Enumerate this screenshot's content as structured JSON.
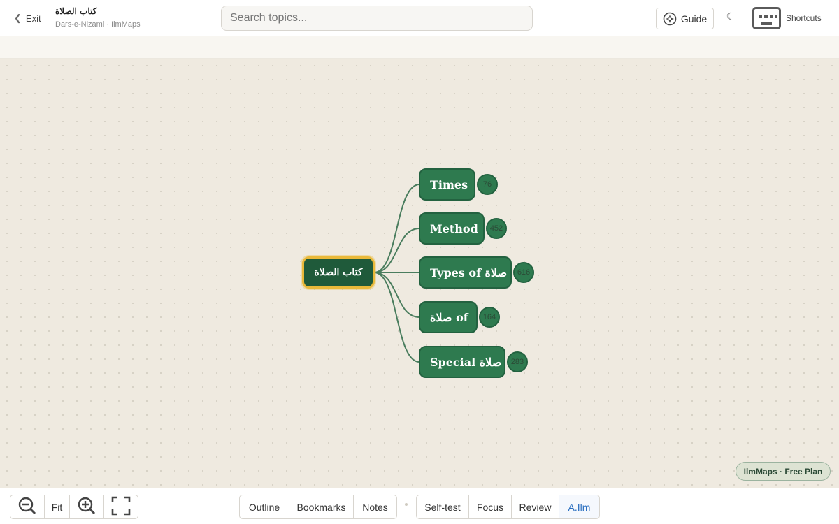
{
  "header": {
    "exit_label": "Exit",
    "title": "كتاب الصلاة",
    "subtitle": "Dars-e-Nizami · IlmMaps",
    "search_placeholder": "Search topics...",
    "guide_label": "Guide",
    "theme_icon": "moon-icon",
    "theme_glyph": "☾",
    "shortcuts_label": "Shortcuts"
  },
  "mindmap": {
    "root": {
      "label": "كتاب الصلاة"
    },
    "children": [
      {
        "label": "Times",
        "count": "76"
      },
      {
        "label": "Method",
        "count": "452"
      },
      {
        "label": "Types of صلاة",
        "count": "616"
      },
      {
        "label": "صلاة of",
        "count": "164"
      },
      {
        "label": "Special صلاة",
        "count": "283"
      }
    ]
  },
  "plan_badge": "IlmMaps · Free Plan",
  "bottom": {
    "zoom": {
      "zoom_out_icon": "zoom-out-icon",
      "fit_label": "Fit",
      "zoom_in_icon": "zoom-in-icon",
      "fullscreen_icon": "fullscreen-icon"
    },
    "panels": [
      "Outline",
      "Bookmarks",
      "Notes"
    ],
    "modes": [
      "Self-test",
      "Focus",
      "Review",
      "A.Ilm"
    ],
    "active_mode": "A.Ilm"
  },
  "colors": {
    "node": "#2e7a4f",
    "root": "#1f5a3a",
    "root_border": "#e9b93a",
    "edge": "#4a7d5e",
    "active": "#2a6fc0"
  }
}
